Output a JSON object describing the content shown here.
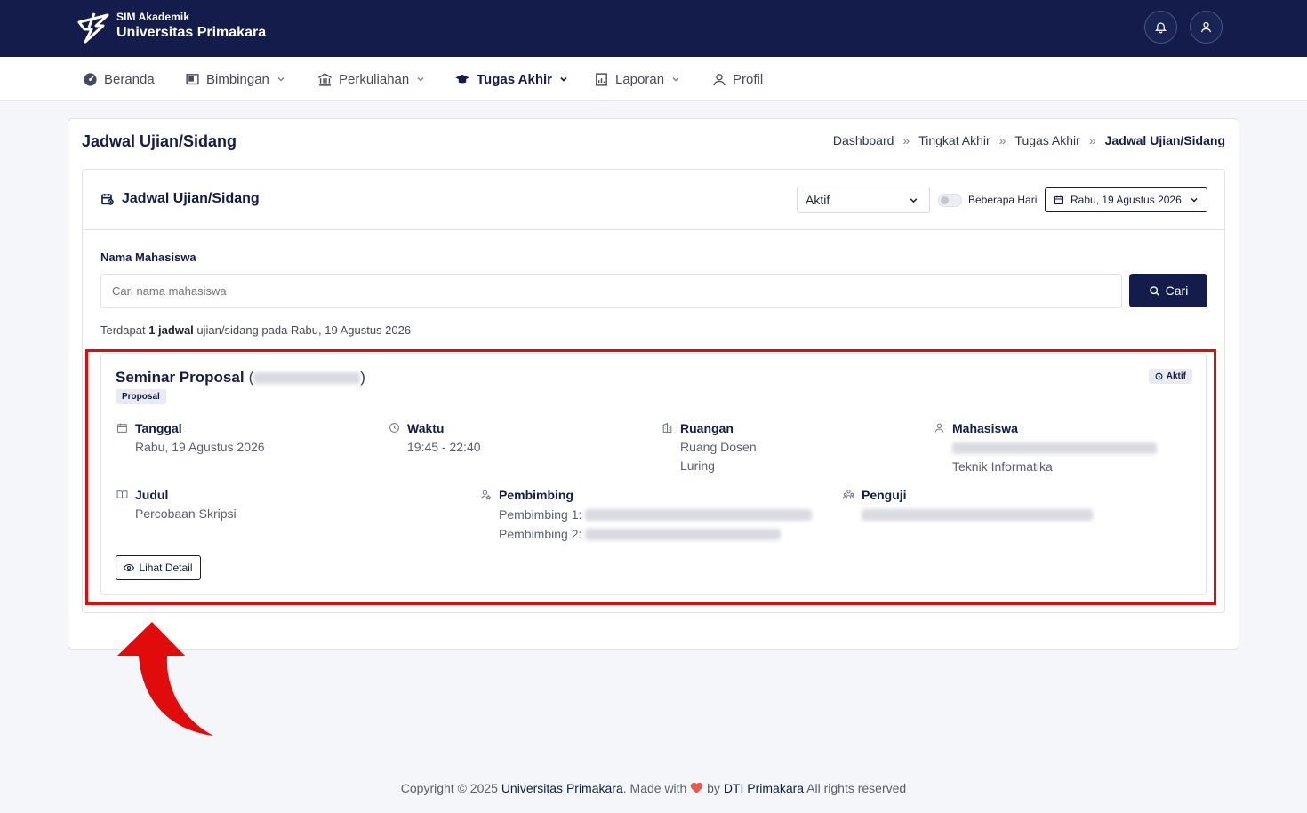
{
  "header": {
    "brand_sub": "SIM Akademik",
    "brand_main": "Universitas Primakara"
  },
  "nav": {
    "items": [
      {
        "label": "Beranda",
        "icon": "dashboard-icon"
      },
      {
        "label": "Bimbingan",
        "icon": "presentation-icon"
      },
      {
        "label": "Perkuliahan",
        "icon": "institution-icon"
      },
      {
        "label": "Tugas Akhir",
        "icon": "graduation-cap-icon",
        "active": true
      },
      {
        "label": "Laporan",
        "icon": "report-icon"
      },
      {
        "label": "Profil",
        "icon": "user-icon"
      }
    ]
  },
  "page": {
    "title": "Jadwal Ujian/Sidang",
    "breadcrumb": [
      "Dashboard",
      "Tingkat Akhir",
      "Tugas Akhir",
      "Jadwal Ujian/Sidang"
    ]
  },
  "schedule": {
    "card_title": "Jadwal Ujian/Sidang",
    "status_select": "Aktif",
    "toggle_label": "Beberapa Hari",
    "date_button": "Rabu, 19 Agustus 2026",
    "search_label": "Nama Mahasiswa",
    "search_placeholder": "Cari nama mahasiswa",
    "search_button": "Cari",
    "summary_prefix": "Terdapat ",
    "summary_bold": "1 jadwal",
    "summary_suffix": " ujian/sidang pada Rabu, 19 Agustus 2026"
  },
  "event": {
    "title": "Seminar Proposal",
    "open_paren": "(",
    "close_paren": ")",
    "type_badge": "Proposal",
    "status_badge": "Aktif",
    "tanggal_label": "Tanggal",
    "tanggal_value": "Rabu, 19 Agustus 2026",
    "waktu_label": "Waktu",
    "waktu_value": "19:45 - 22:40",
    "ruangan_label": "Ruangan",
    "ruangan_value": "Ruang Dosen",
    "ruangan_mode": "Luring",
    "mahasiswa_label": "Mahasiswa",
    "mahasiswa_prodi": "Teknik Informatika",
    "judul_label": "Judul",
    "judul_value": "Percobaan Skripsi",
    "pembimbing_label": "Pembimbing",
    "pembimbing_1_prefix": "Pembimbing 1:",
    "pembimbing_2_prefix": "Pembimbing 2:",
    "penguji_label": "Penguji",
    "detail_button": "Lihat Detail"
  },
  "footer": {
    "prefix": "Copyright © 2025 ",
    "org": "Universitas Primakara",
    "mid": ". Made with ",
    "by": " by ",
    "team": "DTI Primakara",
    "suffix": " All rights reserved"
  },
  "colors": {
    "primary": "#131c4a",
    "highlight": "#e00b0b",
    "heart": "#e85a4f"
  }
}
